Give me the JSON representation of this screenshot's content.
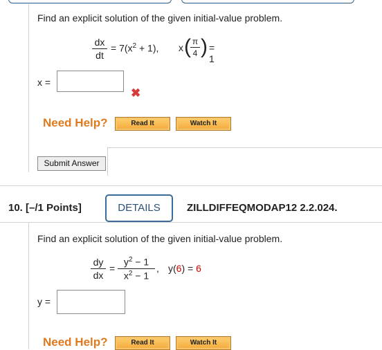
{
  "q9": {
    "instruction": "Find an explicit solution of the given initial-value problem.",
    "eq_num": "dx",
    "eq_den": "dt",
    "eq_rhs_a": "= 7(x",
    "eq_rhs_exp": "2",
    "eq_rhs_b": " + 1),",
    "ic_x": "x",
    "ic_num": "π",
    "ic_den": "4",
    "ic_rhs": "= 1",
    "answer_label": "x =",
    "answer_value": "",
    "need_help": "Need Help?",
    "read_it": "Read It",
    "watch_it": "Watch It",
    "submit": "Submit Answer"
  },
  "q10": {
    "number": "10.  [–/1 Points]",
    "details": "DETAILS",
    "code": "ZILLDIFFEQMODAP12 2.2.024.",
    "instruction": "Find an explicit solution of the given initial-value problem.",
    "lhs_num": "dy",
    "lhs_den": "dx",
    "eq": "=",
    "rhs_num_a": "y",
    "rhs_num_exp": "2",
    "rhs_num_b": " − 1",
    "rhs_den_a": "x",
    "rhs_den_exp": "2",
    "rhs_den_b": " − 1",
    "comma": ",",
    "ic_left": "y(",
    "ic_val": "6",
    "ic_mid": ") = ",
    "ic_rhs": "6",
    "answer_label": "y =",
    "answer_value": "",
    "need_help": "Need Help?",
    "read_it": "Read It",
    "watch_it": "Watch It"
  }
}
